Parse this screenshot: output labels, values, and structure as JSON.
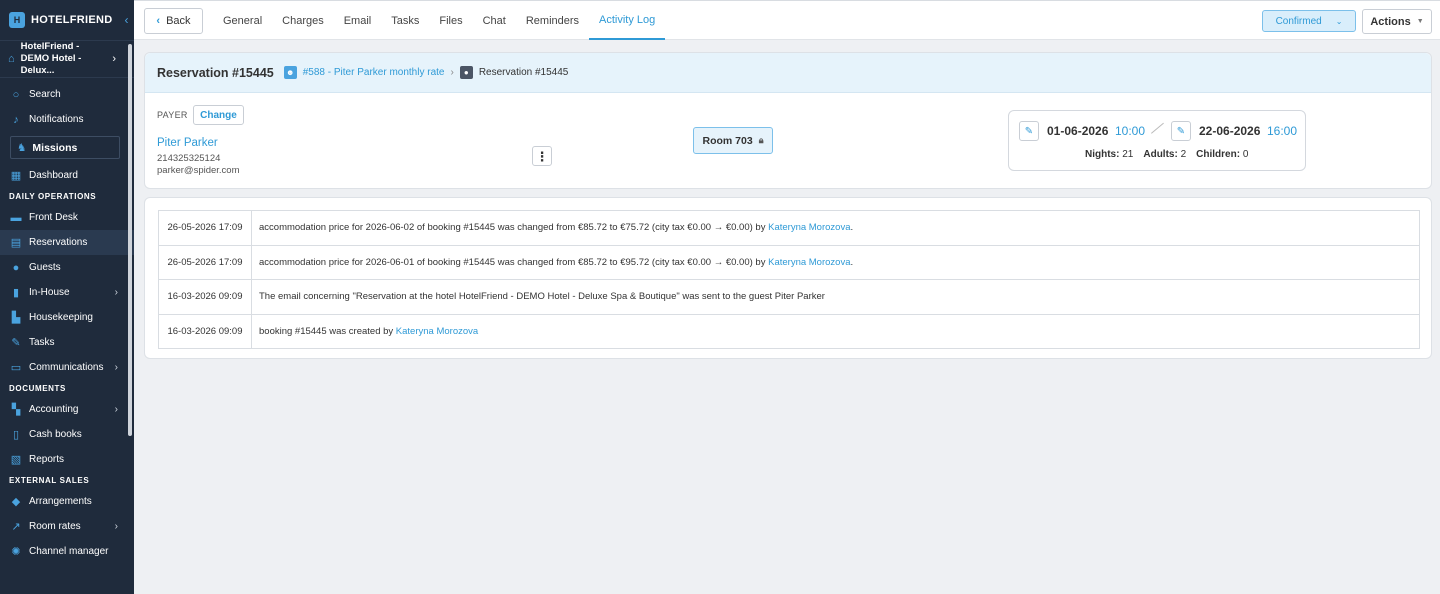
{
  "brand": {
    "name": "HOTELFRIEND",
    "reg": "®"
  },
  "hotel": {
    "name": "HotelFriend - DEMO Hotel - Delux..."
  },
  "nav": {
    "search": "Search",
    "notifications": "Notifications",
    "missions": "Missions",
    "dashboard": "Dashboard",
    "section_daily": "DAILY OPERATIONS",
    "front_desk": "Front Desk",
    "reservations": "Reservations",
    "guests": "Guests",
    "in_house": "In-House",
    "housekeeping": "Housekeeping",
    "tasks": "Tasks",
    "communications": "Communications",
    "section_documents": "DOCUMENTS",
    "accounting": "Accounting",
    "cash_books": "Cash books",
    "reports": "Reports",
    "section_external": "EXTERNAL SALES",
    "arrangements": "Arrangements",
    "room_rates": "Room rates",
    "channel_manager": "Channel manager"
  },
  "topbar": {
    "back": "Back",
    "tabs": [
      "General",
      "Charges",
      "Email",
      "Tasks",
      "Files",
      "Chat",
      "Reminders",
      "Activity Log"
    ],
    "active_tab": "Activity Log",
    "status": "Confirmed",
    "actions": "Actions"
  },
  "reservation": {
    "title": "Reservation #15445",
    "crumb_rate": "#588 - Piter Parker monthly rate",
    "crumb_current": "Reservation #15445",
    "payer_label": "PAYER",
    "change": "Change",
    "payer_name": "Piter Parker",
    "payer_phone": "214325325124",
    "payer_email": "parker@spider.com",
    "room": "Room 703",
    "checkin_date": "01-06-2026",
    "checkin_time": "10:00",
    "checkout_date": "22-06-2026",
    "checkout_time": "16:00",
    "nights_label": "Nights:",
    "nights": "21",
    "adults_label": "Adults:",
    "adults": "2",
    "children_label": "Children:",
    "children": "0"
  },
  "log": [
    {
      "date": "26-05-2026 17:09",
      "text": "accommodation price for 2026-06-02 of booking #15445 was changed from €85.72 to €75.72 (city tax €0.00 → €0.00) by ",
      "author": "Kateryna Morozova",
      "suffix": "."
    },
    {
      "date": "26-05-2026 17:09",
      "text": "accommodation price for 2026-06-01 of booking #15445 was changed from €85.72 to €95.72 (city tax €0.00 → €0.00) by ",
      "author": "Kateryna Morozova",
      "suffix": "."
    },
    {
      "date": "16-03-2026 09:09",
      "text": "The email concerning \"Reservation at the hotel HotelFriend - DEMO Hotel - Deluxe Spa & Boutique\" was sent to the guest Piter Parker",
      "author": "",
      "suffix": ""
    },
    {
      "date": "16-03-2026 09:09",
      "text": "booking #15445 was created by ",
      "author": "Kateryna Morozova",
      "suffix": ""
    }
  ],
  "colors": {
    "sidebar": "#1f2b3c",
    "accent": "#2f9ad6",
    "header_bg": "#e6f3fb"
  }
}
